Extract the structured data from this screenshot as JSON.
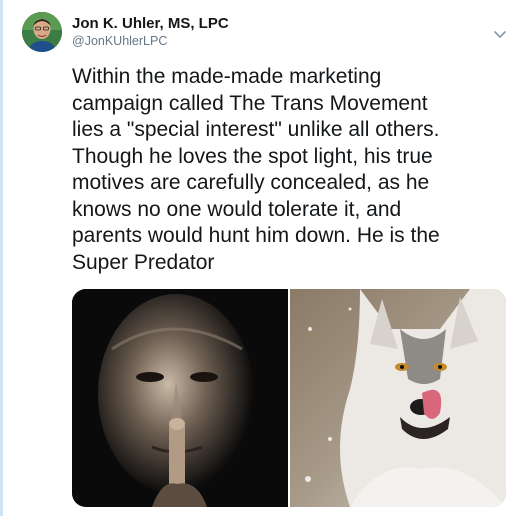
{
  "tweet": {
    "author": {
      "display_name": "Jon K. Uhler, MS, LPC",
      "handle": "@JonKUhlerLPC",
      "avatar_icon": "profile-photo"
    },
    "menu_icon": "chevron-down-icon",
    "text": "Within the made-made marketing\ncampaign called The Trans Movement\nlies a \"special interest\" unlike all others.\nThough he loves the spot light, his true\nmotives are carefully concealed, as he\nknows no one would tolerate it, and\nparents would hunt him down. He is the\nSuper Predator",
    "media": [
      {
        "icon": "man-finger-to-lips-photo"
      },
      {
        "icon": "wolf-licking-lips-photo"
      }
    ]
  },
  "colors": {
    "text": "#14171a",
    "secondary_text": "#657786",
    "thread_line": "#cfe3f3"
  }
}
